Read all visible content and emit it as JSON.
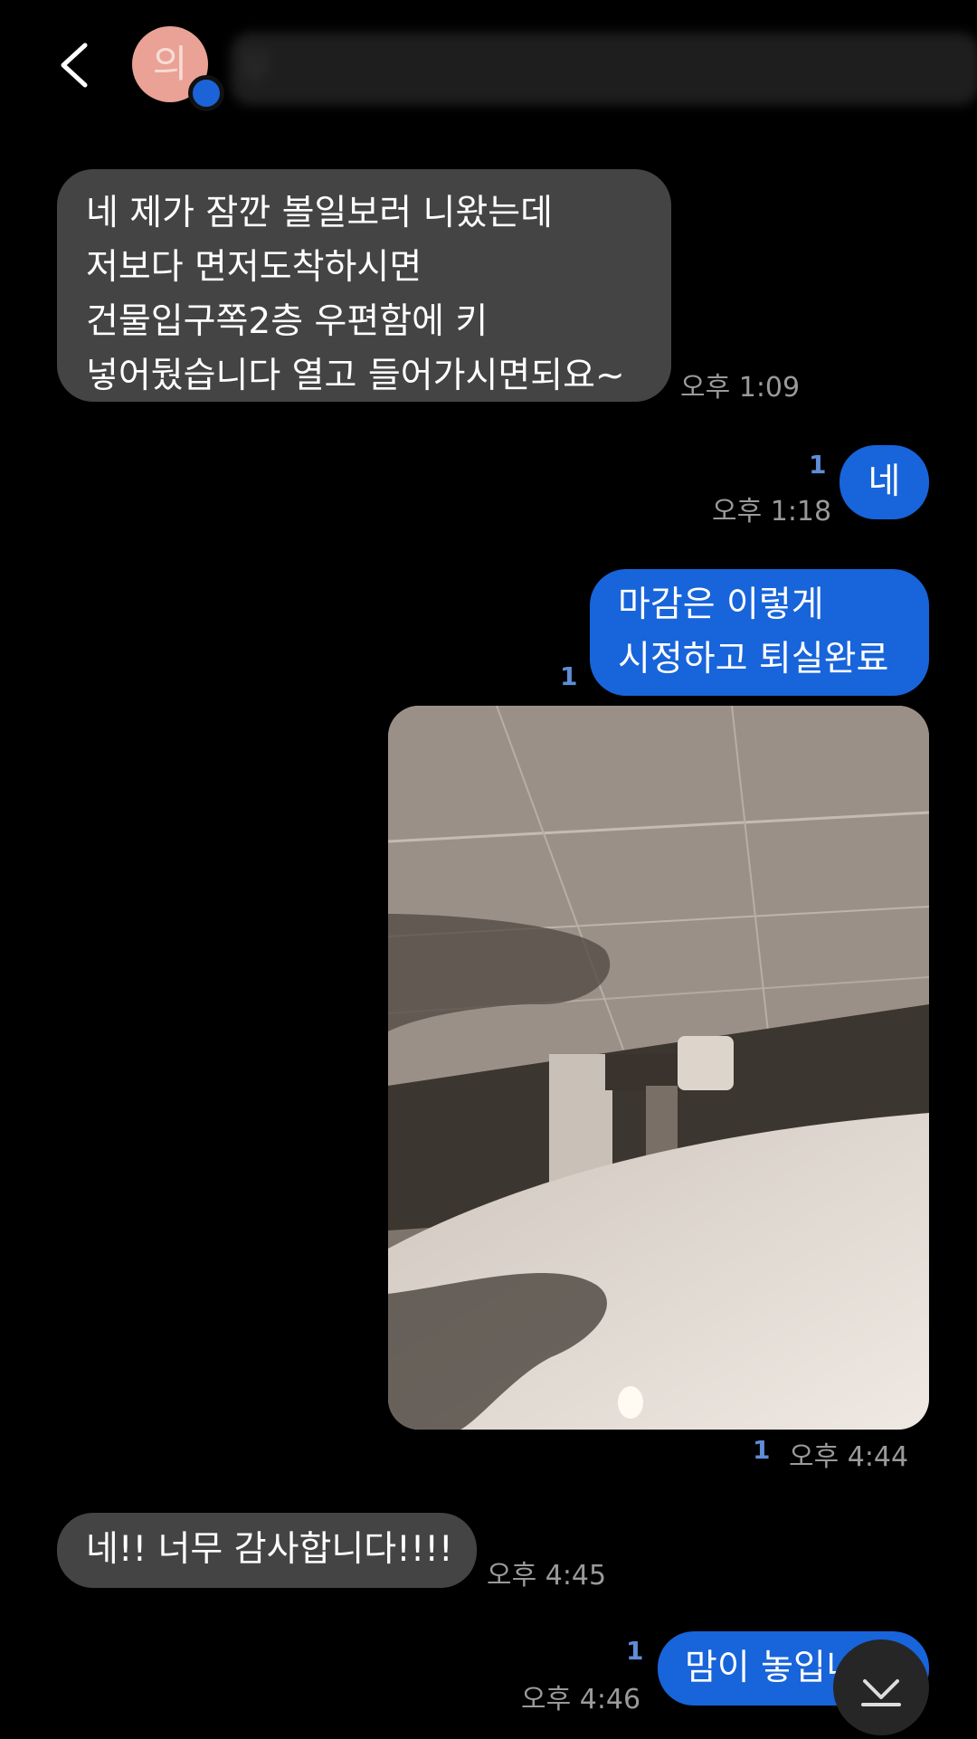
{
  "header": {
    "back_icon": "chevron-left-icon",
    "avatar_text": "의",
    "contact_name": "우"
  },
  "messages": [
    {
      "direction": "incoming",
      "lines": [
        "네 제가 잠깐 볼일보러 니왔는데",
        "저보다 면저도착하시면",
        "건물입구쪽2층 우편함에 키",
        "넣어뒀습니다 열고 들어가시면되요~"
      ],
      "time": "오후 1:09"
    },
    {
      "direction": "outgoing",
      "lines": [
        "네"
      ],
      "read": "1",
      "time": "오후 1:18"
    },
    {
      "direction": "outgoing",
      "lines": [
        "마감은 이렇게",
        "시정하고 퇴실완료"
      ],
      "read": "1"
    },
    {
      "direction": "outgoing",
      "type": "photo",
      "read": "1",
      "time": "오후 4:44"
    },
    {
      "direction": "incoming",
      "lines": [
        "네!! 너무 감사합니다!!!!"
      ],
      "time": "오후 4:45"
    },
    {
      "direction": "outgoing",
      "lines": [
        "맘이 놓입니"
      ],
      "read": "1",
      "time": "오후 4:46"
    }
  ],
  "scroll_button_icon": "chevron-down-bar-icon",
  "colors": {
    "incoming_bubble": "#444444",
    "outgoing_bubble": "#1864da",
    "read_count": "#5e8ed6",
    "timestamp": "#9a9a9a"
  }
}
